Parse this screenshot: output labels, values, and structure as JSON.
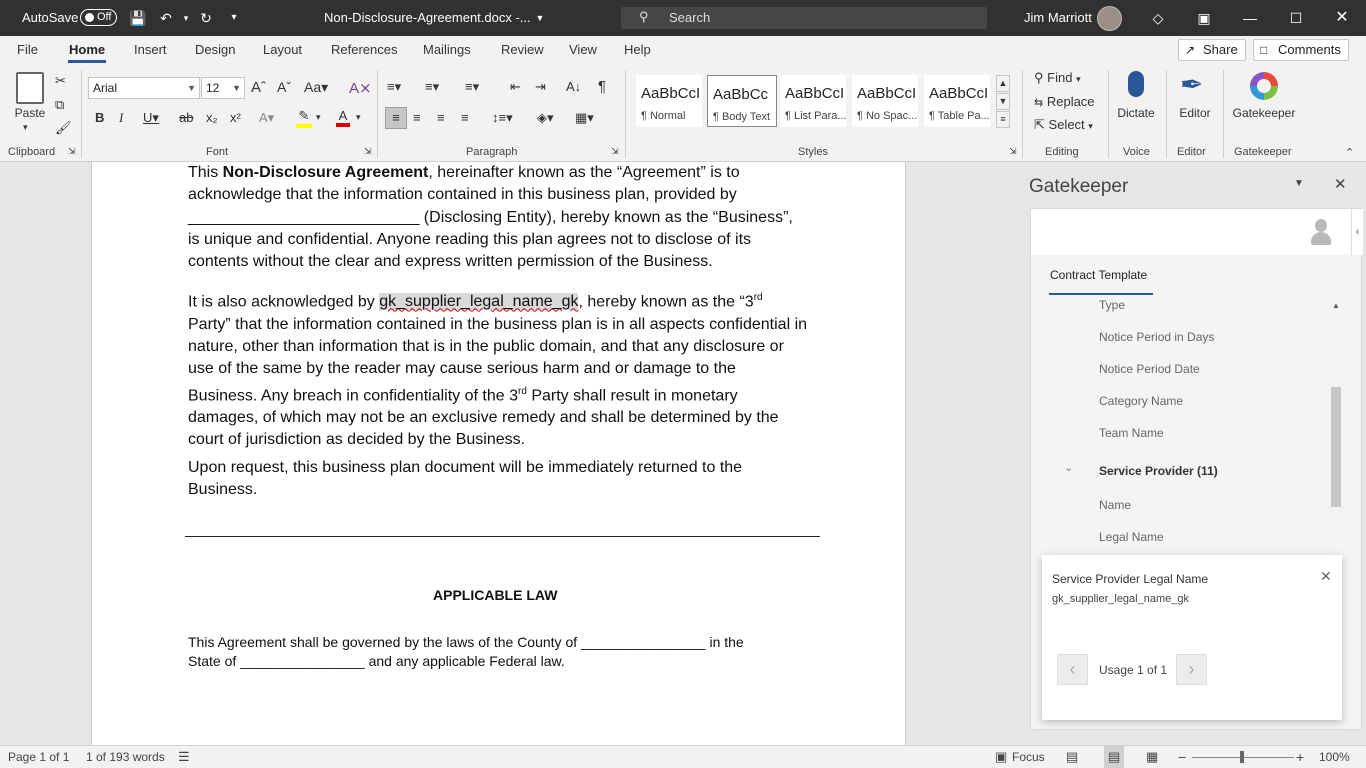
{
  "titlebar": {
    "autosave_label": "AutoSave",
    "autosave_state": "Off",
    "document_title": "Non-Disclosure-Agreement.docx  -...",
    "search_placeholder": "Search",
    "user_name": "Jim Marriott",
    "bg_color": "#323130"
  },
  "ribbon_tabs": [
    "File",
    "Home",
    "Insert",
    "Design",
    "Layout",
    "References",
    "Mailings",
    "Review",
    "View",
    "Help"
  ],
  "active_tab": "Home",
  "share_label": "Share",
  "comments_label": "Comments",
  "ribbon": {
    "paste_label": "Paste",
    "font_name": "Arial",
    "font_size": "12",
    "styles": [
      {
        "preview": "AaBbCcI",
        "name": "¶ Normal"
      },
      {
        "preview": "AaBbCc",
        "name": "¶ Body Text"
      },
      {
        "preview": "AaBbCcI",
        "name": "¶ List Para..."
      },
      {
        "preview": "AaBbCcI",
        "name": "¶ No Spac..."
      },
      {
        "preview": "AaBbCcI",
        "name": "¶ Table Pa..."
      }
    ],
    "find_label": "Find",
    "replace_label": "Replace",
    "select_label": "Select",
    "dictate_label": "Dictate",
    "editor_label": "Editor",
    "gatekeeper_label": "Gatekeeper",
    "groups": {
      "clipboard": "Clipboard",
      "font": "Font",
      "paragraph": "Paragraph",
      "styles": "Styles",
      "editing": "Editing",
      "voice": "Voice",
      "editor": "Editor",
      "gatekeeper": "Gatekeeper"
    },
    "accent_color": "#2b579a"
  },
  "document": {
    "p1_a": "This ",
    "p1_bold": "Non-Disclosure Agreement",
    "p1_b": ", hereinafter known as the “Agreement” is to acknowledge that the information contained in this business plan, provided by __________________________ (Disclosing Entity), hereby known as the “Business”, is unique and confidential. Anyone reading this plan agrees not to disclose of its contents without the clear and express written permission of the Business.",
    "p2_a": "It is also acknowledged by ",
    "p2_hl": "gk_supplier_legal_name_gk",
    "p2_b": ", hereby known as the “3",
    "p2_sup1": "rd",
    "p2_c": " Party” that the information contained in the business plan is in all aspects confidential in nature, other than information that is in the public domain, and that any disclosure or use of the same by the reader may cause serious harm and or damage to the Business. Any breach in confidentiality of the 3",
    "p2_sup2": "rd",
    "p2_d": " Party shall result in monetary damages, of which may not be an exclusive remedy and shall be determined by the court of jurisdiction as decided by the Business.",
    "p3": "Upon request, this business plan document will be immediately returned to the Business.",
    "heading": "APPLICABLE LAW",
    "law_line1": "This Agreement shall be governed by the laws of the County of ________________ in the",
    "law_line2": "State of ________________ and any applicable Federal law."
  },
  "pane": {
    "title": "Gatekeeper",
    "tab": "Contract Template",
    "fields": [
      "Type",
      "Notice Period in Days",
      "Notice Period Date",
      "Category Name",
      "Team Name"
    ],
    "section_title": "Service Provider (11)",
    "section_fields": [
      "Name",
      "Legal Name"
    ],
    "popup_title": "Service Provider Legal Name",
    "popup_value": "gk_supplier_legal_name_gk",
    "usage_text": "Usage 1 of 1"
  },
  "statusbar": {
    "page": "Page 1 of 1",
    "words": "1 of 193 words",
    "focus": "Focus",
    "zoom": "100%"
  }
}
